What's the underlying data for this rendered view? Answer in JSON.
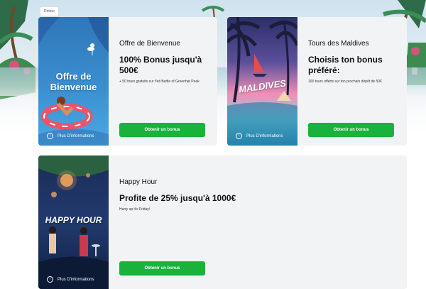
{
  "back_button": "Retour",
  "cards": [
    {
      "art_title": "Offre de Bienvenue",
      "title": "Offre de Bienvenue",
      "headline": "100% Bonus jusqu'à 500€",
      "description": "+ 50 tours gratuits sur Yeti Battle of Greenhat Peak",
      "cta": "Obtenir un bonus",
      "more": "Plus D'informations"
    },
    {
      "art_title": "MALDIVES",
      "title": "Tours des Maldives",
      "headline": "Choisis ton bonus préféré:",
      "description": "100 tours offerts sur ton prochain dépôt de 50€",
      "cta": "Obtenir un bonus",
      "more": "Plus D'informations"
    },
    {
      "art_title": "HAPPY HOUR",
      "title": "Happy Hour",
      "headline": "Profite de 25% jusqu'à 1000€",
      "description": "Hurry up it's Friday!",
      "cta": "Obtenir un bonus",
      "more": "Plus D'informations"
    }
  ],
  "colors": {
    "cta": "#19b23b",
    "card": "#f2f3f4"
  },
  "icons": [
    "info-icon",
    "flamingo-icon",
    "sailboat-icon",
    "palm-tree-icon"
  ]
}
